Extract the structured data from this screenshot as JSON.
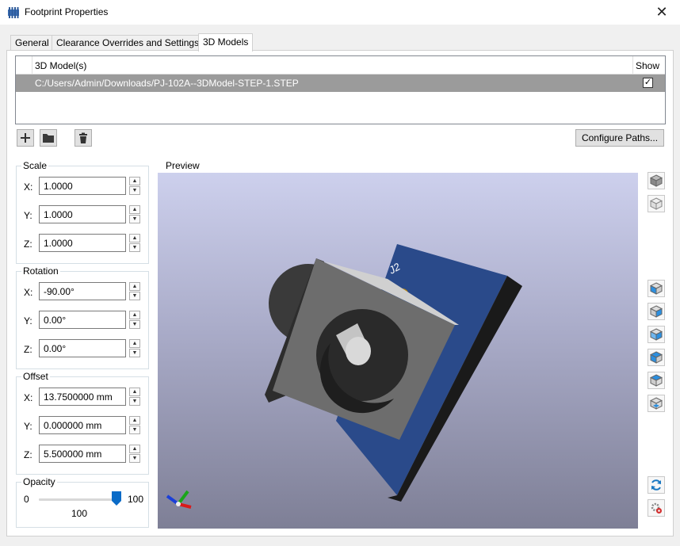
{
  "window": {
    "title": "Footprint Properties",
    "close_glyph": "✕"
  },
  "tabs": [
    {
      "label": "General"
    },
    {
      "label": "Clearance Overrides and Settings"
    },
    {
      "label": "3D Models",
      "active": true
    }
  ],
  "models_table": {
    "col_model": "3D Model(s)",
    "col_show": "Show",
    "rows": [
      {
        "path": "C:/Users/Admin/Downloads/PJ-102A--3DModel-STEP-1.STEP",
        "show": true,
        "check_glyph": "✓"
      }
    ]
  },
  "toolbar": {
    "add_icon": "plus-icon",
    "folder_icon": "folder-icon",
    "delete_icon": "trash-icon",
    "configure_label": "Configure Paths..."
  },
  "scale": {
    "label": "Scale",
    "x_label": "X:",
    "x": "1.0000",
    "y_label": "Y:",
    "y": "1.0000",
    "z_label": "Z:",
    "z": "1.0000"
  },
  "rotation": {
    "label": "Rotation",
    "x_label": "X:",
    "x": "-90.00°",
    "y_label": "Y:",
    "y": "0.00°",
    "z_label": "Z:",
    "z": "0.00°"
  },
  "offset": {
    "label": "Offset",
    "x_label": "X:",
    "x": "13.7500000 mm",
    "y_label": "Y:",
    "y": "0.000000 mm",
    "z_label": "Z:",
    "z": "5.500000 mm"
  },
  "opacity": {
    "label": "Opacity",
    "min": "0",
    "max": "100",
    "value": "100",
    "level_fraction": 1.0
  },
  "preview": {
    "label": "Preview",
    "ref_designator": "J2",
    "background_top": "#cdd0ed",
    "background_bottom": "#7e7f96",
    "board_color": "#2a4a8a"
  },
  "view_buttons": [
    "view-3d-icon",
    "view-3d-wire-icon",
    "view-left-icon",
    "view-right-icon",
    "view-front-icon",
    "view-back-icon",
    "view-top-icon",
    "view-bottom-icon",
    "reload-icon",
    "render-settings-icon"
  ],
  "accent_color": "#0a6bc7"
}
